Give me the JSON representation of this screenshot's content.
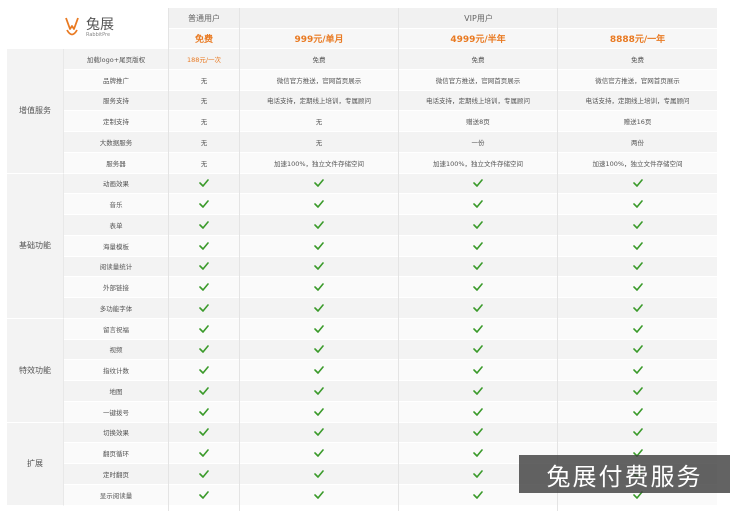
{
  "brand": {
    "name": "兔展",
    "sub": "RabbitPre",
    "color": "#e97a22"
  },
  "header": {
    "normal_user": "普通用户",
    "vip_user": "VIP用户",
    "prices": [
      "免费",
      "999元/单月",
      "4999元/半年",
      "8888元/一年"
    ]
  },
  "groups": [
    {
      "name": "增值服务",
      "rows": [
        {
          "feature": "加载logo+尾页版权",
          "values": [
            "188元/一次",
            "免费",
            "免费",
            "免费"
          ]
        },
        {
          "feature": "品牌推广",
          "values": [
            "无",
            "微信官方推送，官网首页展示",
            "微信官方推送，官网首页展示",
            "微信官方推送，官网首页展示"
          ]
        },
        {
          "feature": "服务支持",
          "values": [
            "无",
            "电话支持，定期线上培训，专属顾问",
            "电话支持，定期线上培训，专属顾问",
            "电话支持，定期线上培训，专属顾问"
          ]
        },
        {
          "feature": "定制支持",
          "values": [
            "无",
            "无",
            "赠送8页",
            "赠送16页"
          ]
        },
        {
          "feature": "大数据服务",
          "values": [
            "无",
            "无",
            "一份",
            "两份"
          ]
        },
        {
          "feature": "服务器",
          "values": [
            "无",
            "加速100%，独立文件存储空间",
            "加速100%，独立文件存储空间",
            "加速100%，独立文件存储空间"
          ]
        }
      ]
    },
    {
      "name": "基础功能",
      "rows": [
        {
          "feature": "动画效果",
          "values": [
            "check",
            "check",
            "check",
            "check"
          ]
        },
        {
          "feature": "音乐",
          "values": [
            "check",
            "check",
            "check",
            "check"
          ]
        },
        {
          "feature": "表单",
          "values": [
            "check",
            "check",
            "check",
            "check"
          ]
        },
        {
          "feature": "海量模板",
          "values": [
            "check",
            "check",
            "check",
            "check"
          ]
        },
        {
          "feature": "阅读量统计",
          "values": [
            "check",
            "check",
            "check",
            "check"
          ]
        },
        {
          "feature": "外部链接",
          "values": [
            "check",
            "check",
            "check",
            "check"
          ]
        },
        {
          "feature": "多功能字体",
          "values": [
            "check",
            "check",
            "check",
            "check"
          ]
        }
      ]
    },
    {
      "name": "特效功能",
      "rows": [
        {
          "feature": "留言祝福",
          "values": [
            "check",
            "check",
            "check",
            "check"
          ]
        },
        {
          "feature": "视频",
          "values": [
            "check",
            "check",
            "check",
            "check"
          ]
        },
        {
          "feature": "指纹计数",
          "values": [
            "check",
            "check",
            "check",
            "check"
          ]
        },
        {
          "feature": "地图",
          "values": [
            "check",
            "check",
            "check",
            "check"
          ]
        },
        {
          "feature": "一键拨号",
          "values": [
            "check",
            "check",
            "check",
            "check"
          ]
        }
      ]
    },
    {
      "name": "扩展",
      "rows": [
        {
          "feature": "切换效果",
          "values": [
            "check",
            "check",
            "check",
            "check"
          ]
        },
        {
          "feature": "翻页循环",
          "values": [
            "check",
            "check",
            "check",
            "check"
          ]
        },
        {
          "feature": "定时翻页",
          "values": [
            "check",
            "check",
            "check",
            "check"
          ]
        },
        {
          "feature": "显示阅读量",
          "values": [
            "check",
            "check",
            "check",
            "check"
          ]
        }
      ]
    }
  ],
  "check_color": "#3a9a2a",
  "watermark": "兔展付费服务"
}
